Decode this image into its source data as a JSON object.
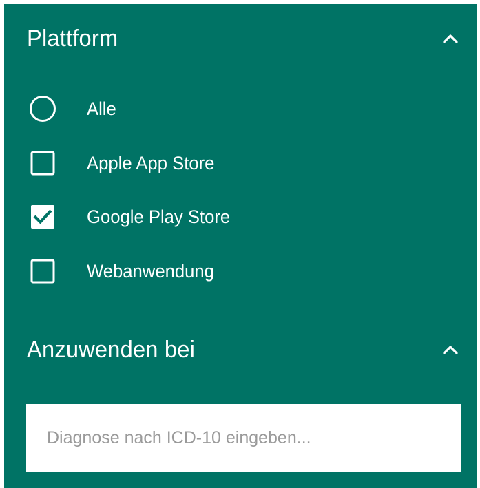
{
  "platform_section": {
    "title": "Plattform",
    "toggle_icon": "chevron-up-icon",
    "options": [
      {
        "label": "Alle",
        "type": "radio",
        "checked": false
      },
      {
        "label": "Apple App Store",
        "type": "checkbox",
        "checked": false
      },
      {
        "label": "Google Play Store",
        "type": "checkbox",
        "checked": true
      },
      {
        "label": "Webanwendung",
        "type": "checkbox",
        "checked": false
      }
    ]
  },
  "apply_section": {
    "title": "Anzuwenden bei",
    "toggle_icon": "chevron-up-icon",
    "search": {
      "value": "",
      "placeholder": "Diagnose nach ICD-10 eingeben..."
    }
  },
  "colors": {
    "panel_background": "#007365",
    "text": "#ffffff",
    "input_background": "#ffffff",
    "placeholder": "#9a9a9a"
  }
}
